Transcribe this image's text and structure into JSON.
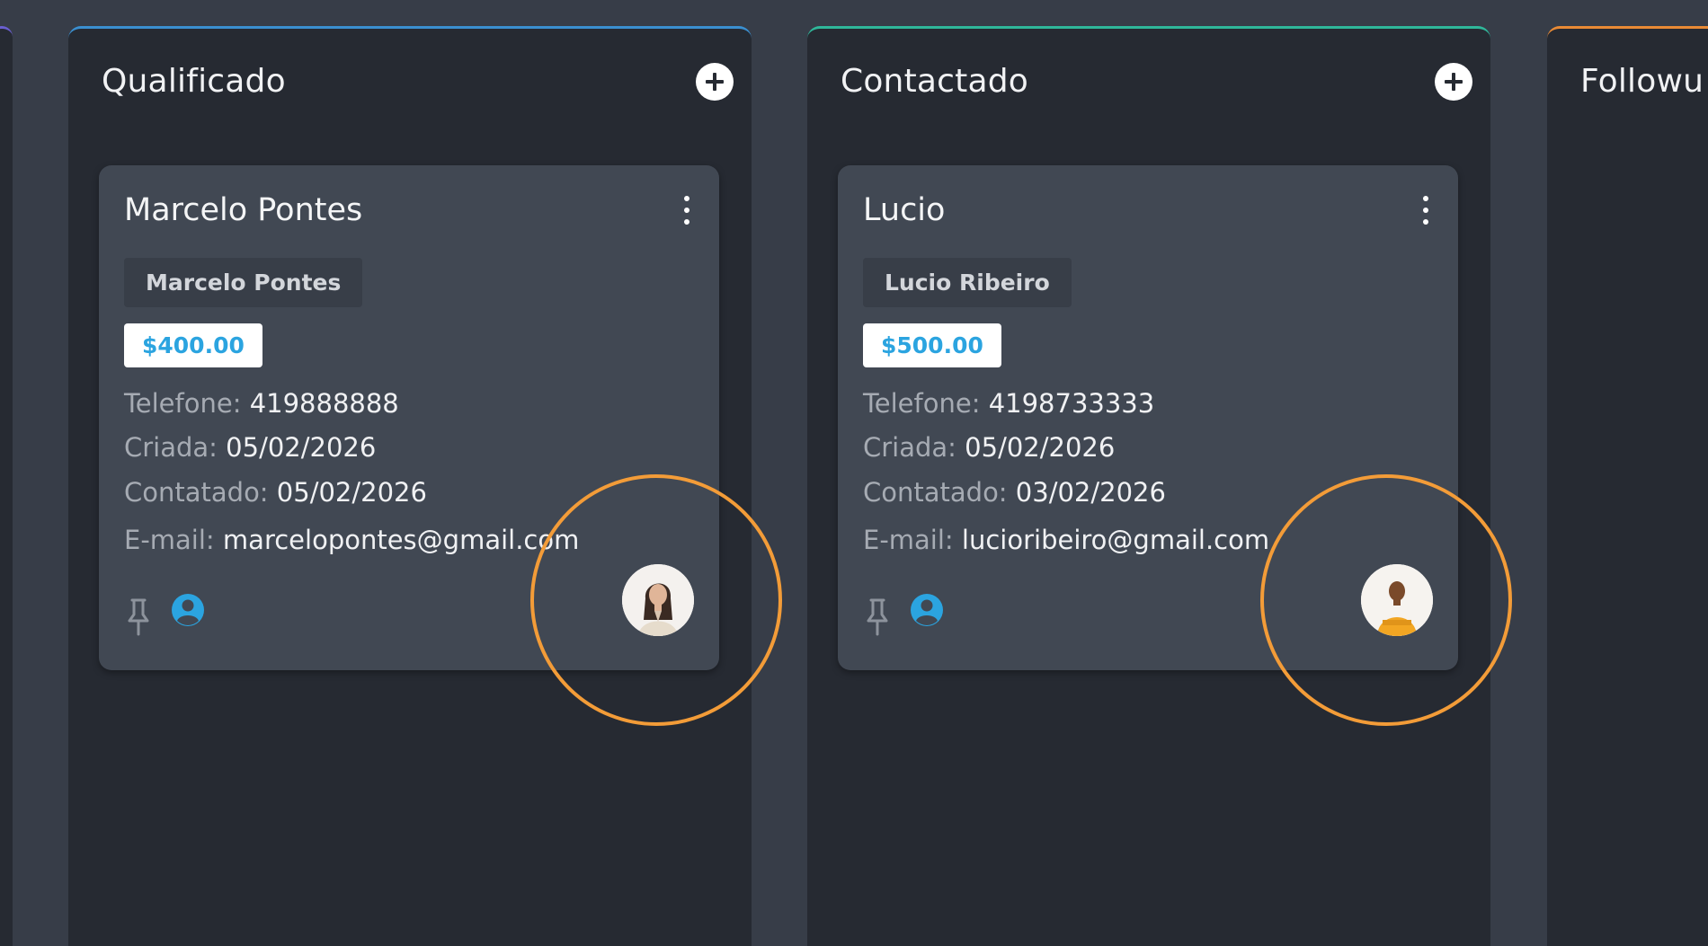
{
  "columns": [
    {
      "title": "Qualificado",
      "accent": "#3a8fd0",
      "card": {
        "name": "Marcelo Pontes",
        "tag": "Marcelo Pontes",
        "price": "$400.00",
        "phone_label": "Telefone:",
        "phone": "419888888",
        "created_label": "Criada:",
        "created": "05/02/2026",
        "contacted_label": "Contatado:",
        "contacted": "05/02/2026",
        "email_label": "E-mail:",
        "email": "marcelopontes@gmail.com"
      }
    },
    {
      "title": "Contactado",
      "accent": "#2fb79a",
      "card": {
        "name": "Lucio",
        "tag": "Lucio Ribeiro",
        "price": "$500.00",
        "phone_label": "Telefone:",
        "phone": "4198733333",
        "created_label": "Criada:",
        "created": "05/02/2026",
        "contacted_label": "Contatado:",
        "contacted": "03/02/2026",
        "email_label": "E-mail:",
        "email": "lucioribeiro@gmail.com"
      }
    },
    {
      "title": "Followu",
      "accent": "#e98a35"
    }
  ],
  "icons": {
    "add": "plus-circle-icon",
    "menu": "kebab-menu-icon",
    "pin": "pin-icon",
    "user": "user-circle-icon",
    "avatar": "avatar"
  },
  "colors": {
    "background": "#373d48",
    "column": "#262a32",
    "card": "#414853",
    "price_text": "#2ba4e0",
    "user_icon": "#2ba4e0",
    "highlight_ring": "#f39c38"
  }
}
